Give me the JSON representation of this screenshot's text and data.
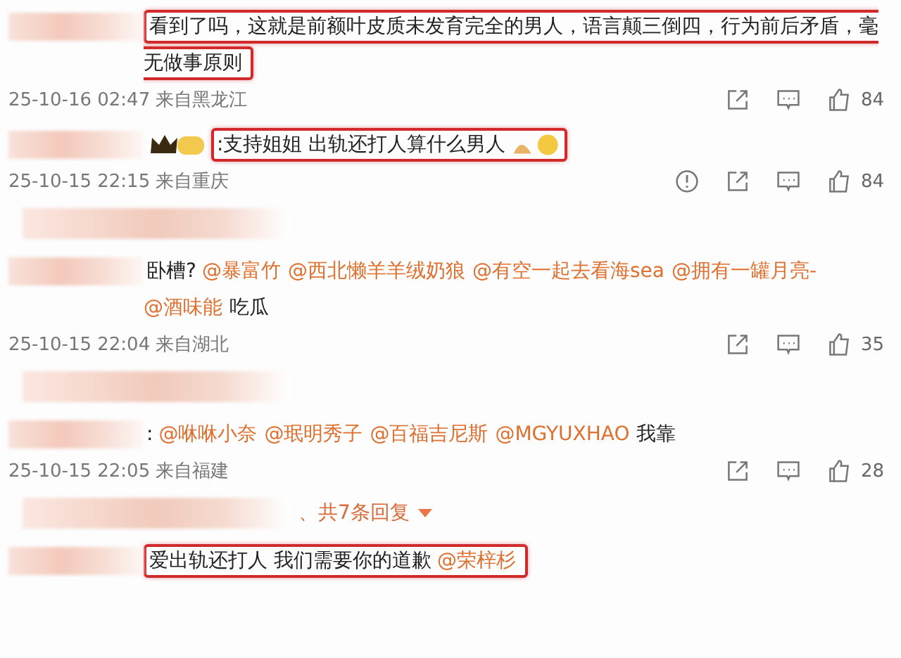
{
  "comments": [
    {
      "highlighted": true,
      "badge": false,
      "emoji_tail": false,
      "parts": [
        {
          "kind": "text",
          "text": "看到了吗，这就是前额叶皮质未发育完全的男人，语言颠三倒四，行为前后矛盾，毫无做事原则"
        }
      ],
      "time": "25-10-16 02:47 来自黑龙江",
      "report": false,
      "likes": "84"
    },
    {
      "highlighted": true,
      "badge": true,
      "emoji_tail": true,
      "parts": [
        {
          "kind": "text",
          "text": ":支持姐姐 出轨还打人算什么男人"
        }
      ],
      "time": "25-10-15 22:15 来自重庆",
      "report": true,
      "likes": "84",
      "replies": {
        "kind": "blurred"
      }
    },
    {
      "highlighted": false,
      "badge": false,
      "emoji_tail": false,
      "parts": [
        {
          "kind": "text",
          "text": "卧槽?"
        },
        {
          "kind": "mention",
          "text": "@暴富竹"
        },
        {
          "kind": "mention",
          "text": "@西北懒羊羊绒奶狼"
        },
        {
          "kind": "mention",
          "text": "@有空一起去看海sea"
        },
        {
          "kind": "mention",
          "text": "@拥有一罐月亮-"
        },
        {
          "kind": "mention",
          "text": "@酒味能"
        },
        {
          "kind": "text",
          "text": "吃瓜"
        }
      ],
      "time": "25-10-15 22:04 来自湖北",
      "report": false,
      "likes": "35",
      "replies": {
        "kind": "blurred"
      }
    },
    {
      "highlighted": false,
      "badge": false,
      "emoji_tail": false,
      "parts": [
        {
          "kind": "text",
          "text": ":"
        },
        {
          "kind": "mention",
          "text": "@咻咻小奈"
        },
        {
          "kind": "mention",
          "text": "@珉明秀子"
        },
        {
          "kind": "mention",
          "text": "@百福吉尼斯"
        },
        {
          "kind": "mention",
          "text": "@MGYUXHAO"
        },
        {
          "kind": "text",
          "text": "我靠"
        }
      ],
      "time": "25-10-15 22:05 来自福建",
      "report": false,
      "likes": "28",
      "replies": {
        "kind": "count",
        "text": "、共7条回复"
      }
    },
    {
      "highlighted": true,
      "badge": false,
      "emoji_tail": false,
      "parts": [
        {
          "kind": "text",
          "text": "爱出轨还打人 我们需要你的道歉"
        },
        {
          "kind": "mention",
          "text": "@荣梓杉"
        }
      ]
    }
  ]
}
